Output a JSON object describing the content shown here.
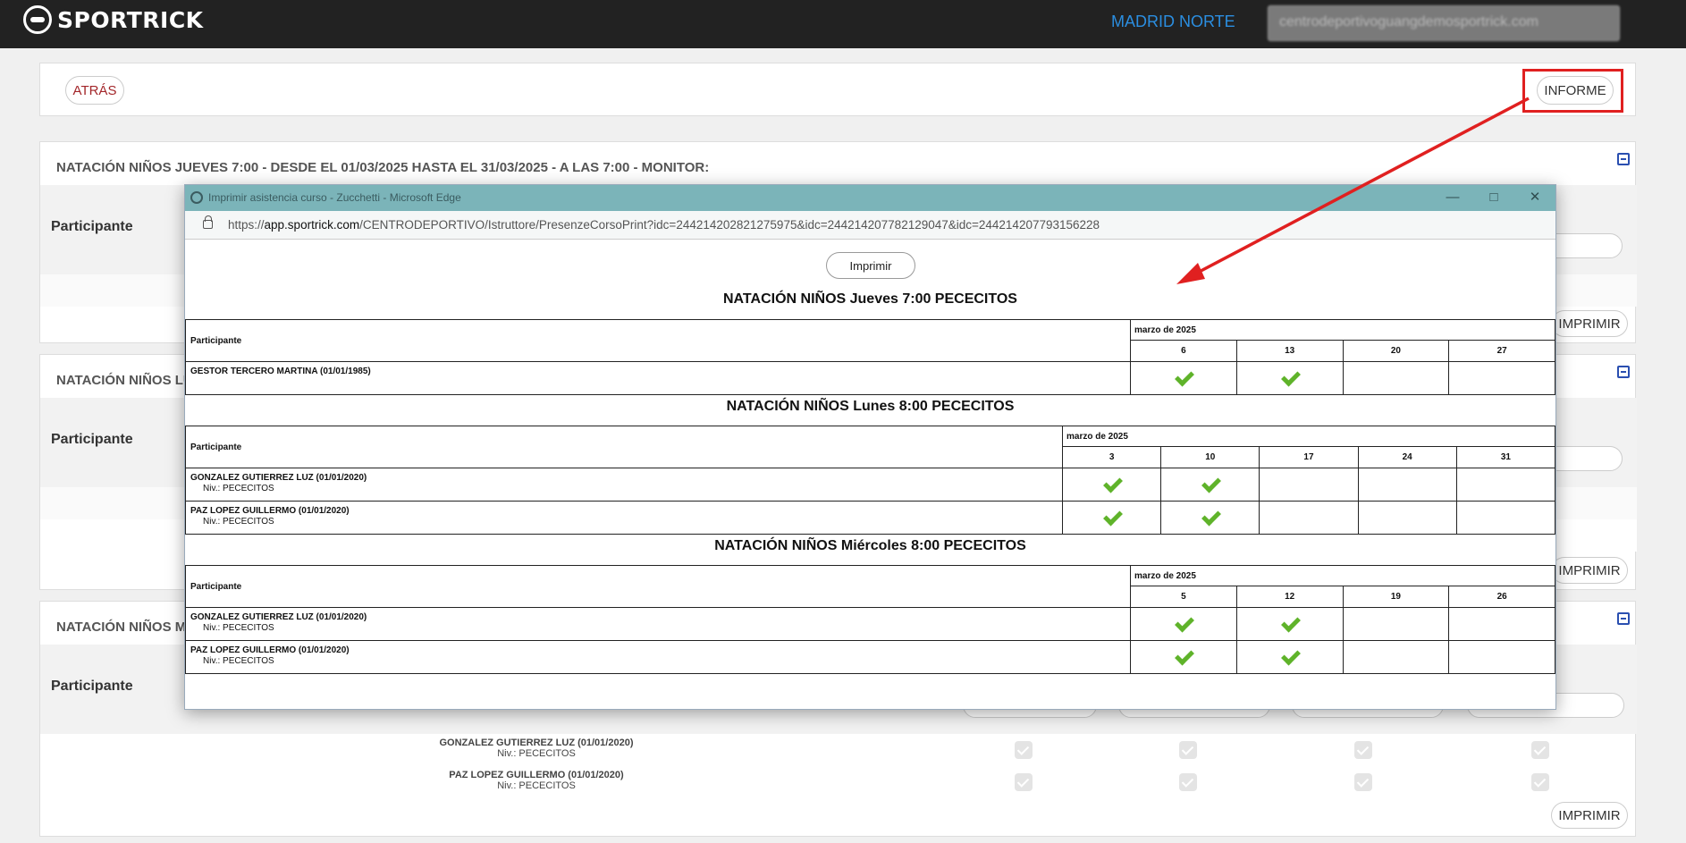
{
  "header": {
    "logo_text": "SPORTRICK",
    "club_name": "MADRID NORTE",
    "user_email": "centrodeportivoguangdemosportrick.com"
  },
  "actions": {
    "back_label": "ATRÁS",
    "report_label": "INFORME"
  },
  "courses": [
    {
      "title": "NATACIÓN NIÑOS JUEVES 7:00 - DESDE EL 01/03/2025 HASTA EL 31/03/2025 - A LAS 7:00 - MONITOR:",
      "participant_label": "Participante",
      "print_label": "IMPRIMIR"
    },
    {
      "title": "NATACIÓN NIÑOS LU",
      "participant_label": "Participante",
      "print_label": "IMPRIMIR"
    },
    {
      "title": "NATACIÓN NIÑOS MI",
      "participant_label": "Participante",
      "print_label": "IMPRIMIR",
      "rows": [
        {
          "name": "GONZALEZ GUTIERREZ LUZ (01/01/2020)",
          "level": "Niv.: PECECITOS"
        },
        {
          "name": "PAZ LOPEZ GUILLERMO (01/01/2020)",
          "level": "Niv.: PECECITOS"
        }
      ]
    }
  ],
  "popup": {
    "window_title": "Imprimir asistencia curso - Zucchetti - Microsoft Edge",
    "url_prefix": "https://",
    "url_domain": "app.sportrick.com",
    "url_path": "/CENTRODEPORTIVO/Istruttore/PresenzeCorsoPrint?idc=244214202821275975&idc=244214207782129047&idc=244214207793156228",
    "print_label": "Imprimir",
    "participant_header": "Participante",
    "sections": [
      {
        "title": "NATACIÓN NIÑOS Jueves 7:00 PECECITOS",
        "month": "marzo de 2025",
        "days": [
          "6",
          "13",
          "20",
          "27"
        ],
        "rows": [
          {
            "name": "GESTOR TERCERO MARTINA (01/01/1985)",
            "level": "",
            "attended": [
              true,
              true,
              false,
              false
            ]
          }
        ]
      },
      {
        "title": "NATACIÓN NIÑOS Lunes 8:00 PECECITOS",
        "month": "marzo de 2025",
        "days": [
          "3",
          "10",
          "17",
          "24",
          "31"
        ],
        "rows": [
          {
            "name": "GONZALEZ GUTIERREZ LUZ (01/01/2020)",
            "level": "Niv.: PECECITOS",
            "attended": [
              true,
              true,
              false,
              false,
              false
            ]
          },
          {
            "name": "PAZ LOPEZ GUILLERMO (01/01/2020)",
            "level": "Niv.: PECECITOS",
            "attended": [
              true,
              true,
              false,
              false,
              false
            ]
          }
        ]
      },
      {
        "title": "NATACIÓN NIÑOS Miércoles 8:00 PECECITOS",
        "month": "marzo de 2025",
        "days": [
          "5",
          "12",
          "19",
          "26"
        ],
        "rows": [
          {
            "name": "GONZALEZ GUTIERREZ LUZ (01/01/2020)",
            "level": "Niv.: PECECITOS",
            "attended": [
              true,
              true,
              false,
              false
            ]
          },
          {
            "name": "PAZ LOPEZ GUILLERMO (01/01/2020)",
            "level": "Niv.: PECECITOS",
            "attended": [
              true,
              true,
              false,
              false
            ]
          }
        ]
      }
    ]
  },
  "colors": {
    "accent_blue": "#2b8ee0",
    "highlight_red": "#e02020",
    "popup_titlebar": "#7bb4b9",
    "check_green": "#5fb32a"
  }
}
